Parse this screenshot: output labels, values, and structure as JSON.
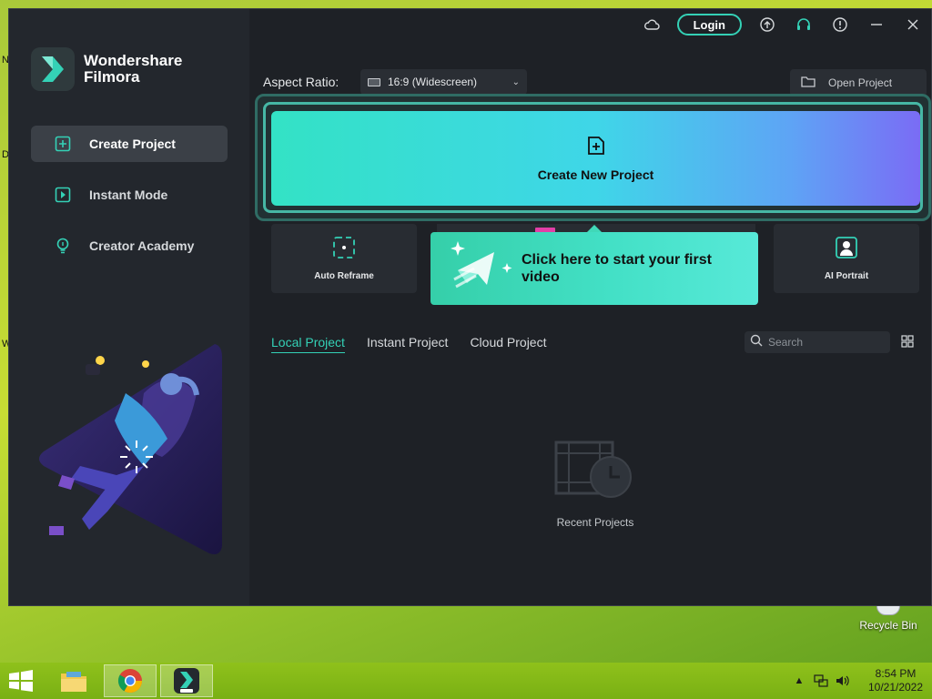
{
  "desktop": {
    "edge_letters": [
      "N",
      "D",
      "W"
    ],
    "recycle_bin_label": "Recycle Bin"
  },
  "app": {
    "brand": {
      "line1": "Wondershare",
      "line2": "Filmora"
    },
    "titlebar": {
      "login_label": "Login"
    },
    "sidebar": {
      "items": [
        {
          "label": "Create Project",
          "icon": "add-project-icon",
          "active": true
        },
        {
          "label": "Instant Mode",
          "icon": "instant-mode-icon",
          "active": false
        },
        {
          "label": "Creator Academy",
          "icon": "lightbulb-icon",
          "active": false
        }
      ]
    },
    "toolbar": {
      "aspect_label": "Aspect Ratio:",
      "aspect_value": "16:9 (Widescreen)",
      "open_project_label": "Open Project"
    },
    "create": {
      "label": "Create New Project"
    },
    "tiles": [
      {
        "label": "Auto Reframe",
        "icon": "auto-reframe-icon"
      },
      {
        "label": "AI Portrait",
        "icon": "ai-portrait-icon"
      }
    ],
    "tooltip": {
      "text": "Click here to start your first video"
    },
    "tabs": [
      {
        "label": "Local Project",
        "active": true
      },
      {
        "label": "Instant Project",
        "active": false
      },
      {
        "label": "Cloud Project",
        "active": false
      }
    ],
    "search": {
      "placeholder": "Search",
      "value": ""
    },
    "empty_state": {
      "caption": "Recent Projects"
    },
    "colors": {
      "accent": "#34d1b6",
      "background": "#1e2126",
      "sidebar": "#23272d"
    }
  },
  "taskbar": {
    "clock_time": "8:54 PM",
    "clock_date": "10/21/2022",
    "pinned": [
      "file-explorer-icon",
      "chrome-icon",
      "filmora-icon"
    ]
  }
}
